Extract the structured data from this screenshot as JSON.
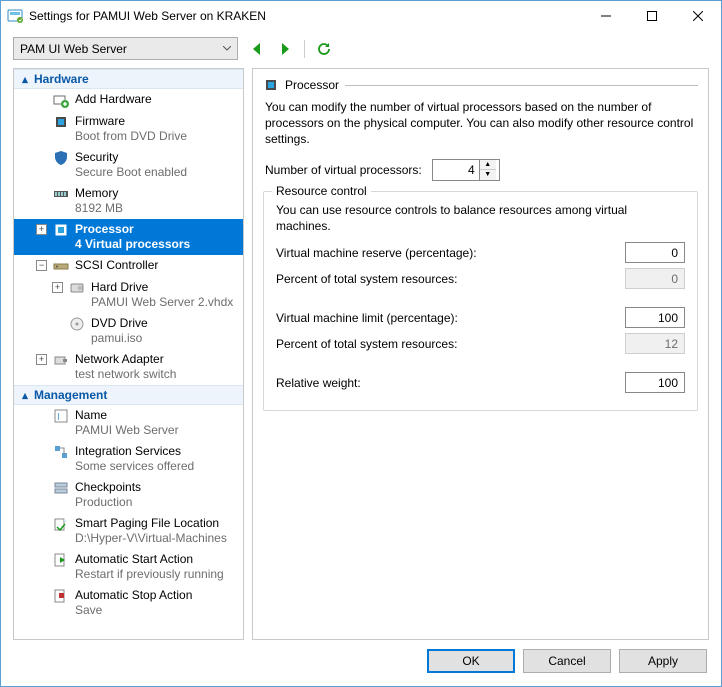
{
  "titlebar": {
    "title": "Settings for PAMUI Web Server on KRAKEN"
  },
  "toolbar": {
    "vm_selected": "PAM UI Web Server"
  },
  "tree": {
    "hardware_label": "Hardware",
    "management_label": "Management",
    "add_hardware": "Add Hardware",
    "firmware": {
      "label": "Firmware",
      "sub": "Boot from DVD Drive"
    },
    "security": {
      "label": "Security",
      "sub": "Secure Boot enabled"
    },
    "memory": {
      "label": "Memory",
      "sub": "8192 MB"
    },
    "processor": {
      "label": "Processor",
      "sub": "4 Virtual processors"
    },
    "scsi": {
      "label": "SCSI Controller"
    },
    "hard_drive": {
      "label": "Hard Drive",
      "sub": "PAMUI Web Server 2.vhdx"
    },
    "dvd_drive": {
      "label": "DVD Drive",
      "sub": "pamui.iso"
    },
    "network": {
      "label": "Network Adapter",
      "sub": "test network switch"
    },
    "name": {
      "label": "Name",
      "sub": "PAMUI Web Server"
    },
    "integration": {
      "label": "Integration Services",
      "sub": "Some services offered"
    },
    "checkpoints": {
      "label": "Checkpoints",
      "sub": "Production"
    },
    "paging": {
      "label": "Smart Paging File Location",
      "sub": "D:\\Hyper-V\\Virtual-Machines"
    },
    "auto_start": {
      "label": "Automatic Start Action",
      "sub": "Restart if previously running"
    },
    "auto_stop": {
      "label": "Automatic Stop Action",
      "sub": "Save"
    }
  },
  "panel": {
    "heading": "Processor",
    "description": "You can modify the number of virtual processors based on the number of processors on the physical computer. You can also modify other resource control settings.",
    "num_vp_label": "Number of virtual processors:",
    "num_vp_value": "4",
    "group_title": "Resource control",
    "group_desc": "You can use resource controls to balance resources among virtual machines.",
    "reserve_label": "Virtual machine reserve (percentage):",
    "reserve_value": "0",
    "reserve_pct_label": "Percent of total system resources:",
    "reserve_pct_value": "0",
    "limit_label": "Virtual machine limit (percentage):",
    "limit_value": "100",
    "limit_pct_label": "Percent of total system resources:",
    "limit_pct_value": "12",
    "weight_label": "Relative weight:",
    "weight_value": "100"
  },
  "footer": {
    "ok": "OK",
    "cancel": "Cancel",
    "apply": "Apply"
  }
}
